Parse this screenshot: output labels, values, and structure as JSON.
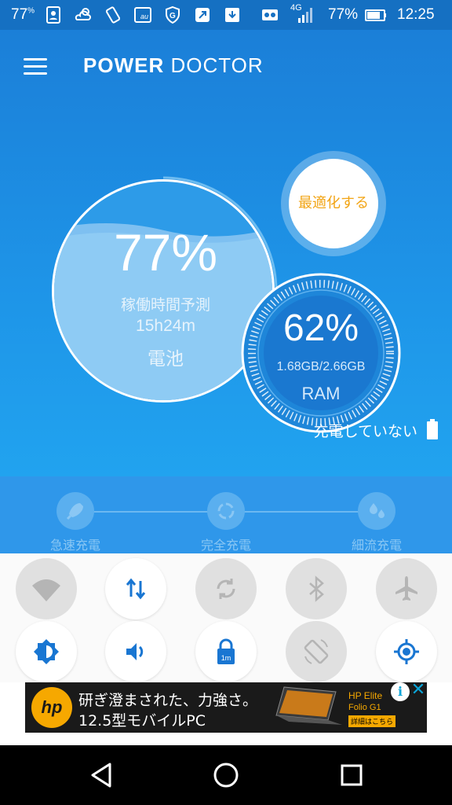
{
  "status_bar": {
    "temp": "77",
    "temp_unit": "%",
    "battery_percent": "77%",
    "network": "4G",
    "time": "12:25"
  },
  "header": {
    "title_bold": "POWER",
    "title_light": "DOCTOR"
  },
  "battery": {
    "percent": "77%",
    "estimate_label": "稼働時間予測",
    "estimate_value": "15h24m",
    "label": "電池"
  },
  "optimize_button": "最適化する",
  "ram": {
    "percent": "62%",
    "usage": "1.68GB/2.66GB",
    "label": "RAM"
  },
  "charge_status": "充電していない",
  "charge_modes": [
    {
      "label": "急速充電",
      "icon": "rocket-icon"
    },
    {
      "label": "完全充電",
      "icon": "cycle-icon"
    },
    {
      "label": "細流充電",
      "icon": "drops-icon"
    }
  ],
  "quick_settings": [
    {
      "name": "wifi",
      "icon": "wifi-icon",
      "state": "off"
    },
    {
      "name": "mobile-data",
      "icon": "data-arrows-icon",
      "state": "on"
    },
    {
      "name": "sync",
      "icon": "sync-icon",
      "state": "off"
    },
    {
      "name": "bluetooth",
      "icon": "bluetooth-icon",
      "state": "off"
    },
    {
      "name": "airplane",
      "icon": "airplane-icon",
      "state": "off"
    },
    {
      "name": "brightness",
      "icon": "brightness-icon",
      "state": "on"
    },
    {
      "name": "sound",
      "icon": "volume-icon",
      "state": "on"
    },
    {
      "name": "screen-timeout",
      "icon": "lock-timer-icon",
      "state": "on",
      "badge": "1m"
    },
    {
      "name": "auto-rotate",
      "icon": "rotate-icon",
      "state": "off"
    },
    {
      "name": "location",
      "icon": "location-icon",
      "state": "on"
    }
  ],
  "ad": {
    "logo": "hp",
    "line1": "研ぎ澄まされた、力強さ。",
    "line2": "12.5型モバイルPC",
    "product1": "HP Elite",
    "product2": "Folio G1",
    "cta": "詳細はこちら"
  },
  "colors": {
    "primary_blue": "#1f8ee0",
    "status_bar": "#1570c2",
    "accent_orange": "#f2a516",
    "active_icon_blue": "#1976d2"
  }
}
